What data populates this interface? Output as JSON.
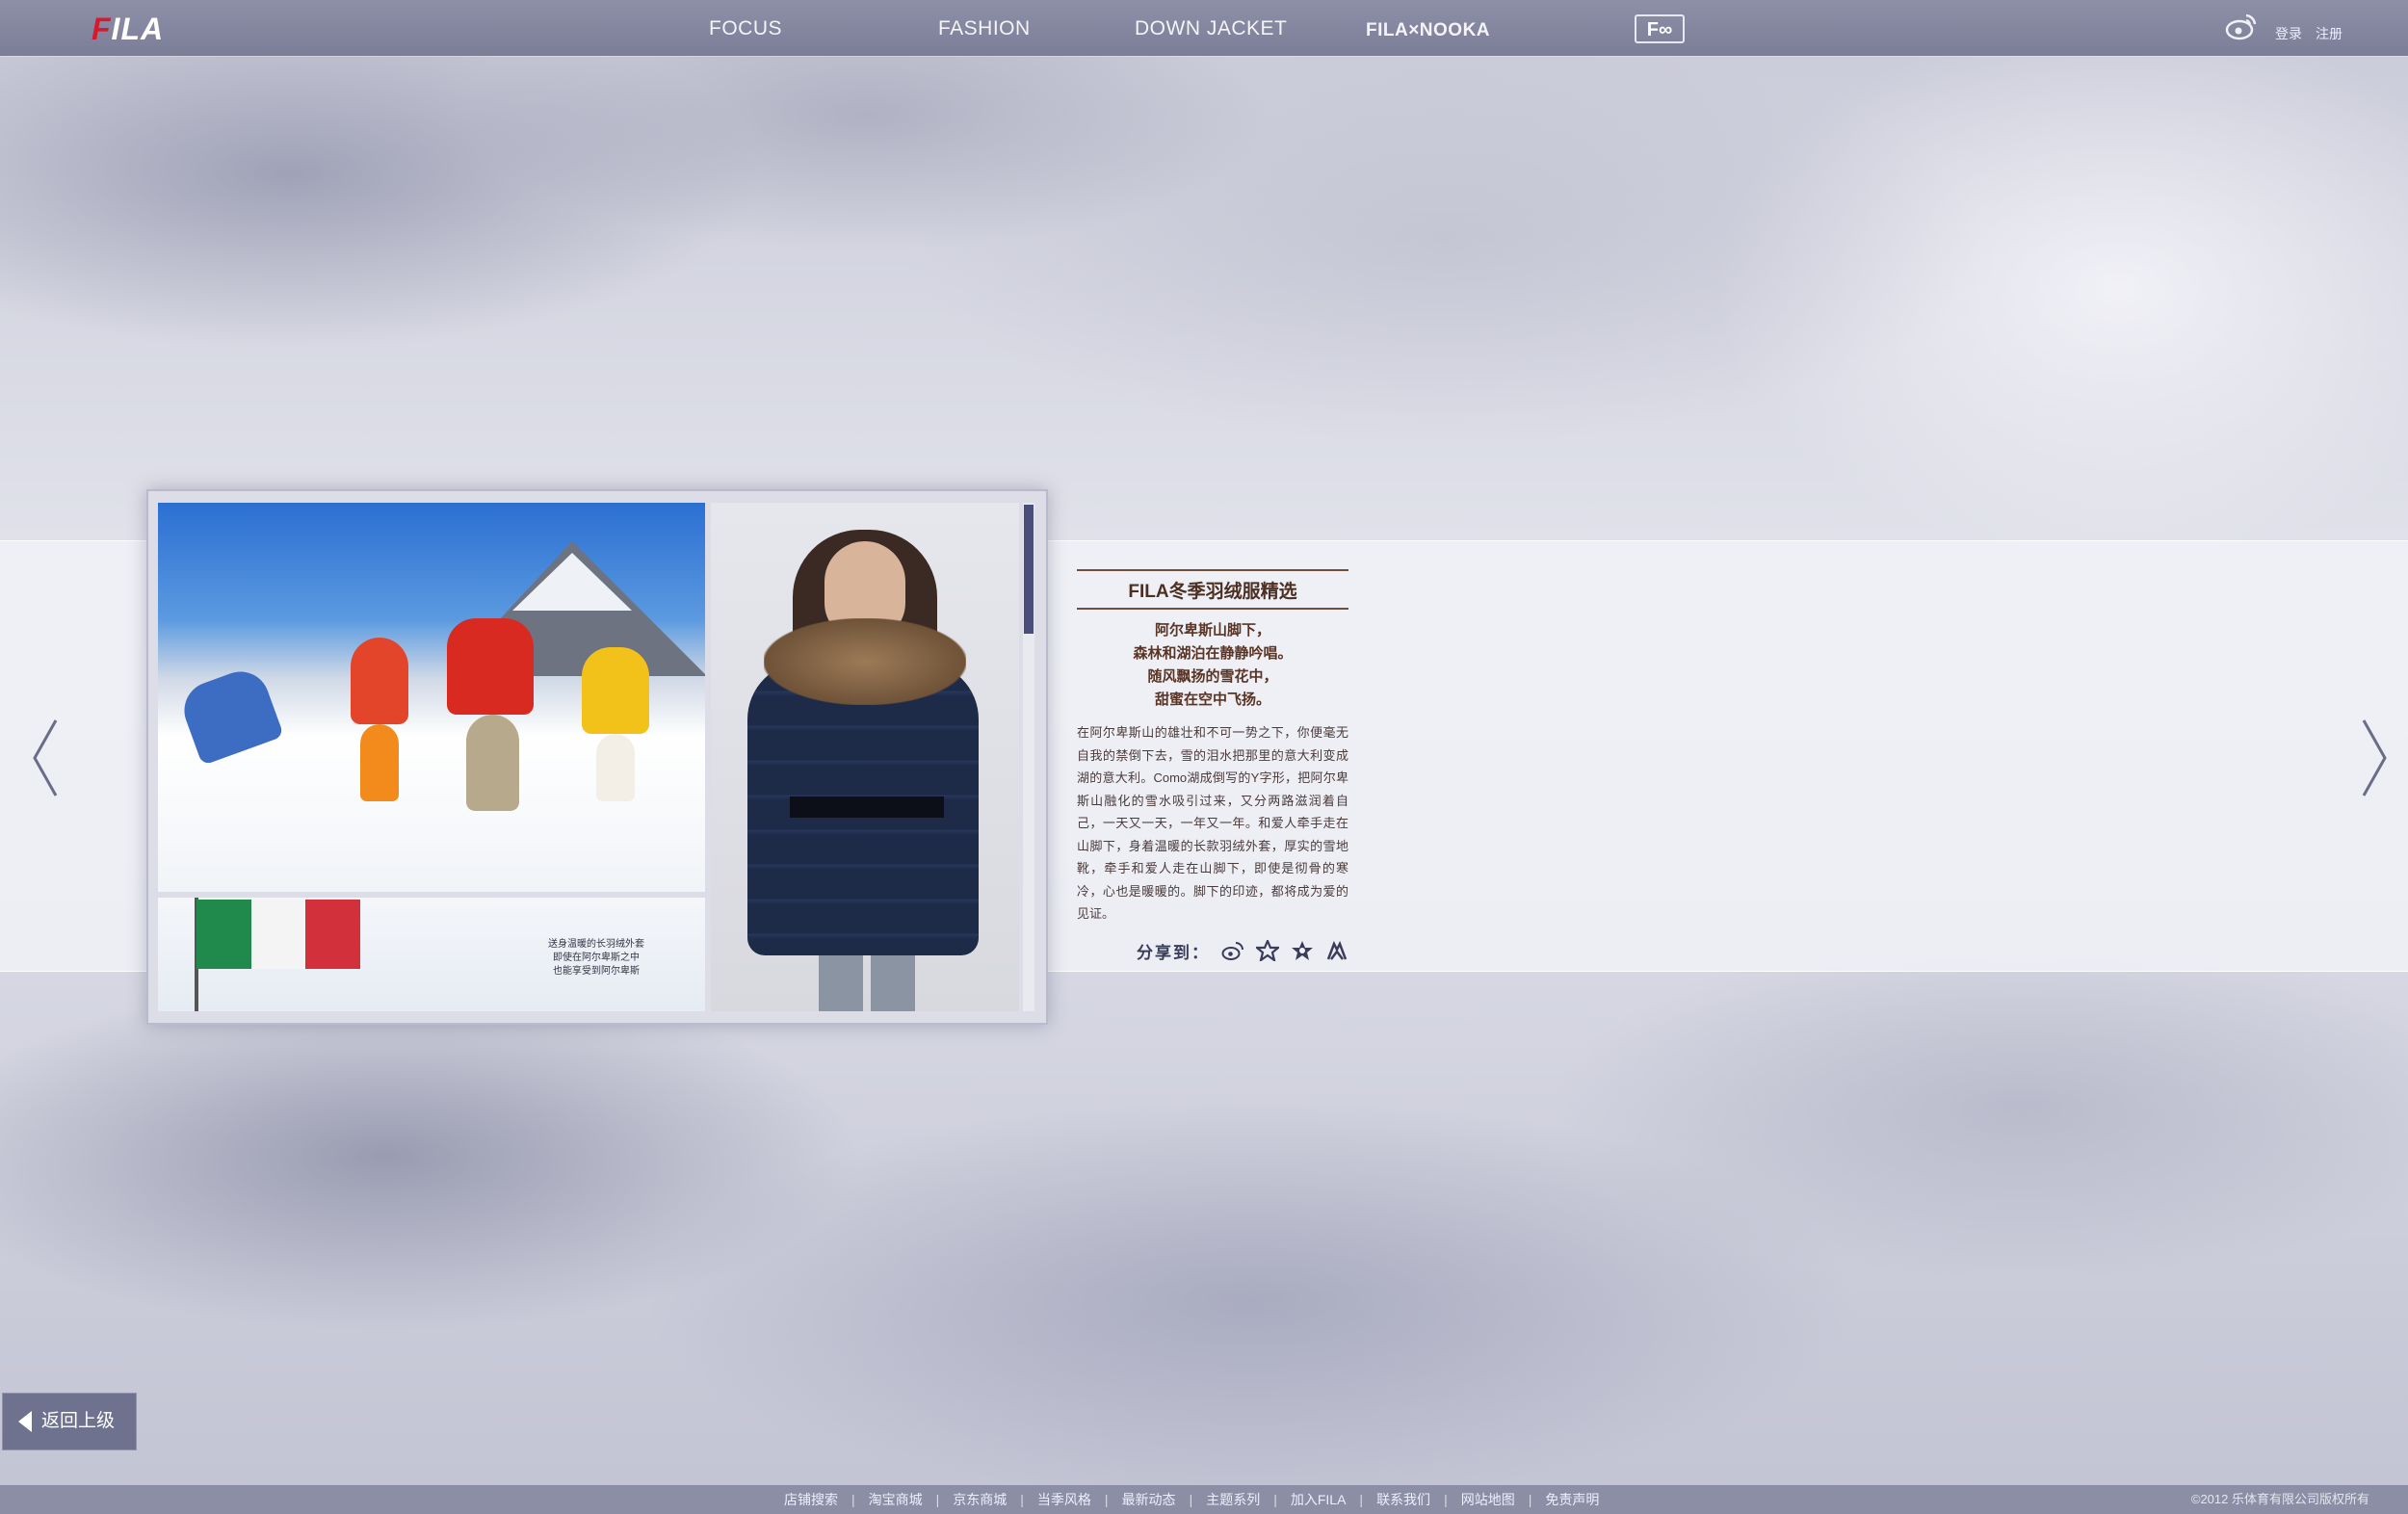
{
  "header": {
    "logo": {
      "prefix": "F",
      "rest": "ILA"
    },
    "nav": [
      {
        "label": "FOCUS"
      },
      {
        "label": "FASHION"
      },
      {
        "label": "DOWN JACKET"
      },
      {
        "label": "FILA×NOOKA"
      }
    ],
    "fo_icon_label": "F∞",
    "login": "登录",
    "register": "注册"
  },
  "gallery": {
    "caption_lines": [
      "送身温暖的长羽绒外套",
      "即使在阿尔卑斯之中",
      "也能享受到阿尔卑斯"
    ]
  },
  "article": {
    "title": "FILA冬季羽绒服精选",
    "poem": [
      "阿尔卑斯山脚下，",
      "森林和湖泊在静静吟唱。",
      "随风飘扬的雪花中，",
      "甜蜜在空中飞扬。"
    ],
    "body": "在阿尔卑斯山的雄壮和不可一势之下，你便毫无自我的禁倒下去，雪的泪水把那里的意大利变成湖的意大利。Como湖成倒写的Y字形，把阿尔卑斯山融化的雪水吸引过来，又分两路滋润着自己，一天又一天，一年又一年。和爱人牵手走在山脚下，身着温暖的长款羽绒外套，厚实的雪地靴，牵手和爱人走在山脚下，即使是彻骨的寒冷，心也是暖暖的。脚下的印迹，都将成为爱的见证。",
    "share_label": "分享到："
  },
  "back_button": {
    "label": "返回上级"
  },
  "footer": {
    "links": [
      "店铺搜索",
      "淘宝商城",
      "京东商城",
      "当季风格",
      "最新动态",
      "主题系列",
      "加入FILA",
      "联系我们",
      "网站地图",
      "免责声明"
    ],
    "copyright": "©2012   乐体育有限公司版权所有"
  },
  "colors": {
    "topbar": "#8e90a8",
    "accent_brown": "#4b2f22",
    "brand_red": "#d7192d",
    "scroll_thumb": "#4a4f7a"
  },
  "icons": [
    "weibo-icon",
    "left-arrow-icon",
    "right-arrow-icon",
    "share-weibo-icon",
    "share-qzone-icon",
    "share-star-icon",
    "share-renren-icon",
    "back-arrow-icon"
  ]
}
